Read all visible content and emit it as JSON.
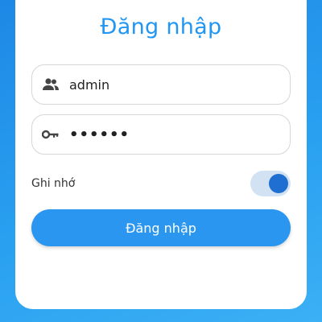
{
  "login": {
    "title": "Đăng nhập",
    "username": {
      "value": "admin",
      "icon": "people-icon"
    },
    "password": {
      "value": "••••••",
      "icon": "key-icon"
    },
    "remember": {
      "label": "Ghi nhớ",
      "on": true
    },
    "submit_label": "Đăng nhập"
  },
  "colors": {
    "accent": "#2196f3",
    "button": "#2a96ef",
    "toggle_knob": "#1e6fd1",
    "toggle_track": "#d2e2f3"
  }
}
